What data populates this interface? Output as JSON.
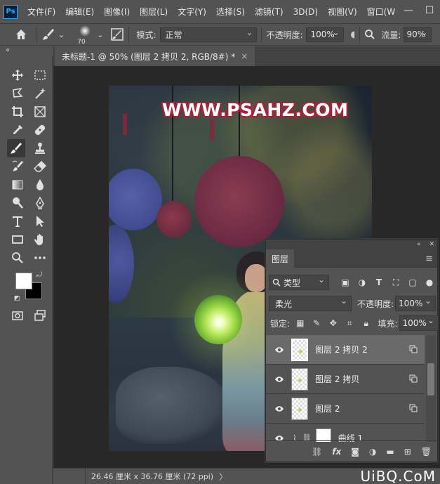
{
  "app": {
    "logo": "Ps"
  },
  "menu": [
    "文件(F)",
    "编辑(E)",
    "图像(I)",
    "图层(L)",
    "文字(Y)",
    "选择(S)",
    "滤镜(T)",
    "3D(D)",
    "视图(V)",
    "窗口(W"
  ],
  "window_controls": {
    "minimize": "—",
    "maximize": "☐"
  },
  "options": {
    "brush_size": "70",
    "mode_label": "模式:",
    "mode_value": "正常",
    "opacity_label": "不透明度:",
    "opacity_value": "100%",
    "flow_label": "流量:",
    "flow_value": "90%"
  },
  "document": {
    "tab_title": "未标题-1 @ 50% (图层 2 拷贝 2, RGB/8#) *",
    "close": "×",
    "status": "26.46 厘米 x 36.76 厘米 (72 ppi)",
    "watermark": "WWW.PSAHZ.COM",
    "brand": "UiBQ.CoM"
  },
  "colors": {
    "foreground": "#ffffff",
    "background": "#000000",
    "accent": "#31a8ff"
  },
  "layers_panel": {
    "tab": "图层",
    "filter": "类型",
    "blend_mode": "柔光",
    "opacity_label": "不透明度:",
    "opacity_value": "100%",
    "lock_label": "锁定:",
    "fill_label": "填充:",
    "fill_value": "100%",
    "layers": [
      {
        "name": "图层 2 拷贝 2",
        "selected": true
      },
      {
        "name": "图层 2 拷贝",
        "selected": false
      },
      {
        "name": "图层 2",
        "selected": false
      },
      {
        "name": "曲线 1",
        "selected": false
      }
    ],
    "bottom_fx": "fx"
  }
}
